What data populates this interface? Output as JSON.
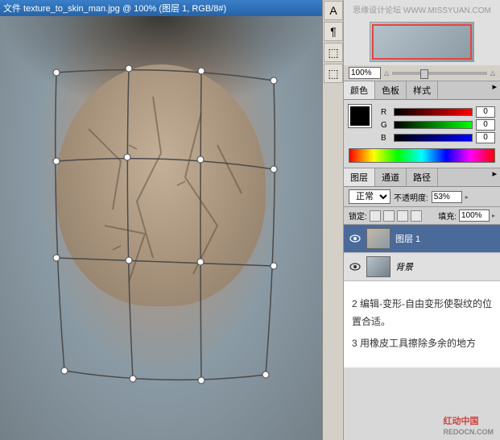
{
  "title": "文件 texture_to_skin_man.jpg @ 100% (图层 1, RGB/8#)",
  "watermark_top": "思缘设计论坛  WWW.MISSYUAN.COM",
  "watermark_bottom": {
    "main": "红动中国",
    "sub": "REDOCN.COM"
  },
  "zoom": {
    "value": "100%"
  },
  "vtools": [
    "A",
    "¶",
    "⬚",
    "⬚"
  ],
  "color_tabs": {
    "t1": "颜色",
    "t2": "色板",
    "t3": "样式"
  },
  "rgb": {
    "r_label": "R",
    "r_val": "0",
    "g_label": "G",
    "g_val": "0",
    "b_label": "B",
    "b_val": "0"
  },
  "layer_tabs": {
    "t1": "图层",
    "t2": "通道",
    "t3": "路径"
  },
  "layer_opts": {
    "blend_label": "正常",
    "opacity_label": "不透明度:",
    "opacity_val": "53%",
    "lock_label": "锁定:",
    "fill_label": "填充:",
    "fill_val": "100%"
  },
  "layers": {
    "l1": "图层 1",
    "l2": "背景"
  },
  "instructions": {
    "step2": "2  编辑-变形-自由变形使裂纹的位置合适。",
    "step3": "3 用橡皮工具擦除多余的地方"
  },
  "sliders": {
    "r_grad": "linear-gradient(90deg,#000,#f00)",
    "g_grad": "linear-gradient(90deg,#000,#0f0)",
    "b_grad": "linear-gradient(90deg,#000,#00f)"
  }
}
